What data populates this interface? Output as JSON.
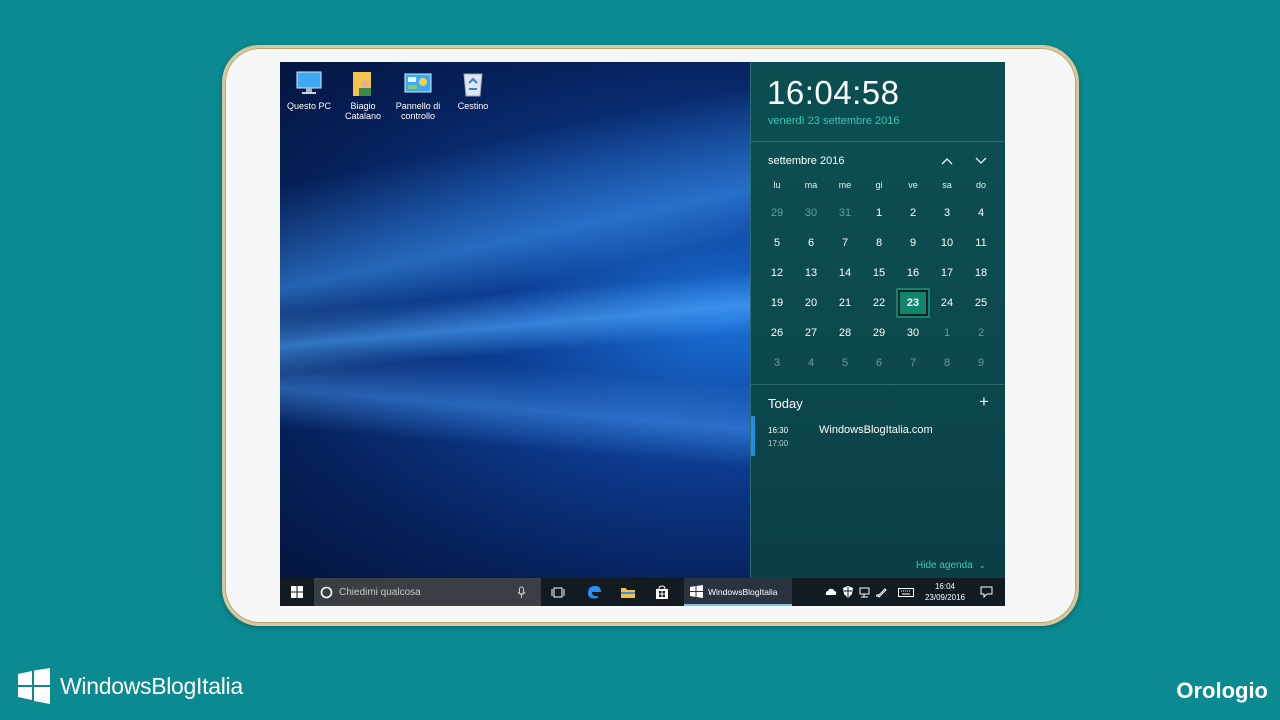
{
  "desktop": {
    "icons": [
      {
        "label": "Questo PC",
        "icon": "computer-icon"
      },
      {
        "label": "Biagio Catalano",
        "icon": "user-folder-icon"
      },
      {
        "label": "Pannello di controllo",
        "icon": "control-panel-icon"
      },
      {
        "label": "Cestino",
        "icon": "recycle-bin-icon"
      }
    ]
  },
  "action_center": {
    "time": "16:04:58",
    "date": "venerdì 23 settembre 2016",
    "month_label": "settembre 2016",
    "weekdays": [
      "lu",
      "ma",
      "me",
      "gi",
      "ve",
      "sa",
      "do"
    ],
    "weeks": [
      [
        {
          "d": "29",
          "dim": true
        },
        {
          "d": "30",
          "dim": true
        },
        {
          "d": "31",
          "dim": true
        },
        {
          "d": "1"
        },
        {
          "d": "2"
        },
        {
          "d": "3"
        },
        {
          "d": "4"
        }
      ],
      [
        {
          "d": "5"
        },
        {
          "d": "6"
        },
        {
          "d": "7"
        },
        {
          "d": "8"
        },
        {
          "d": "9"
        },
        {
          "d": "10"
        },
        {
          "d": "11"
        }
      ],
      [
        {
          "d": "12"
        },
        {
          "d": "13"
        },
        {
          "d": "14"
        },
        {
          "d": "15"
        },
        {
          "d": "16"
        },
        {
          "d": "17"
        },
        {
          "d": "18"
        }
      ],
      [
        {
          "d": "19"
        },
        {
          "d": "20"
        },
        {
          "d": "21"
        },
        {
          "d": "22"
        },
        {
          "d": "23",
          "today": true
        },
        {
          "d": "24"
        },
        {
          "d": "25"
        }
      ],
      [
        {
          "d": "26"
        },
        {
          "d": "27"
        },
        {
          "d": "28"
        },
        {
          "d": "29"
        },
        {
          "d": "30"
        },
        {
          "d": "1",
          "dim": true
        },
        {
          "d": "2",
          "dim": true
        }
      ],
      [
        {
          "d": "3",
          "dim": true
        },
        {
          "d": "4",
          "dim": true
        },
        {
          "d": "5",
          "dim": true
        },
        {
          "d": "6",
          "dim": true
        },
        {
          "d": "7",
          "dim": true
        },
        {
          "d": "8",
          "dim": true
        },
        {
          "d": "9",
          "dim": true
        }
      ]
    ],
    "agenda": {
      "heading": "Today",
      "event": {
        "start": "16:30",
        "end": "17:00",
        "title": "WindowsBlogItalia.com"
      }
    },
    "hide_agenda": "Hide agenda"
  },
  "taskbar": {
    "search_placeholder": "Chiedimi qualcosa",
    "active_app": "WindowsBlogItalia",
    "clock_time": "16:04",
    "clock_date": "23/09/2016"
  },
  "branding": {
    "logo_text": "WindowsBlogItalia",
    "section": "Orologio"
  },
  "colors": {
    "background": "#0b8a92",
    "accent": "#10846f",
    "date_text": "#39c6b4"
  }
}
